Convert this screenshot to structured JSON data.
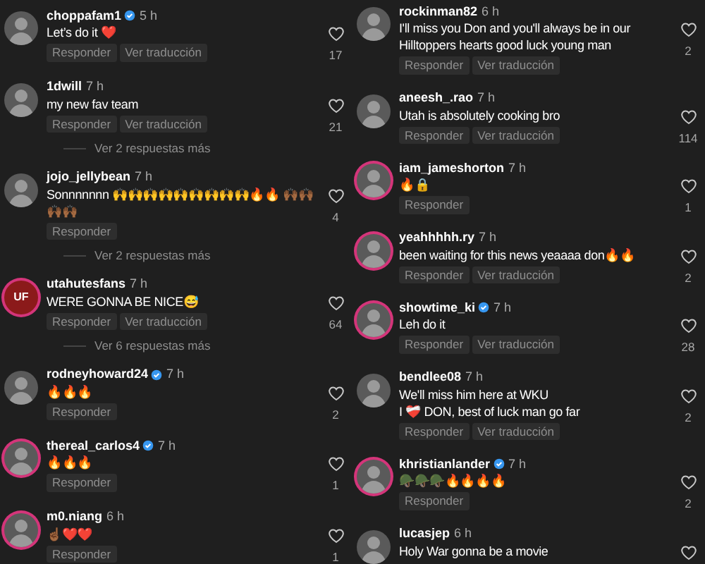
{
  "columns": [
    {
      "comments": [
        {
          "username": "choppafam1",
          "verified": true,
          "time": "5 h",
          "story_ring": false,
          "lines": [
            "Let’s do it ❤️"
          ],
          "actions": [
            "Responder",
            "Ver traducción"
          ],
          "likes": "17"
        },
        {
          "username": "1dwill",
          "verified": false,
          "time": "7 h",
          "story_ring": false,
          "lines": [
            "my new fav team"
          ],
          "actions": [
            "Responder",
            "Ver traducción"
          ],
          "likes": "21",
          "replies": "Ver 2 respuestas más"
        },
        {
          "username": "jojo_jellybean",
          "verified": false,
          "time": "7 h",
          "story_ring": false,
          "lines": [
            "Sonnnnnnn 🙌🙌🙌🙌🙌🙌🙌🙌🙌🔥🔥 🙌🏾🙌🏾🙌🏾🙌🏾"
          ],
          "actions": [
            "Responder"
          ],
          "likes": "4",
          "replies": "Ver 2 respuestas más"
        },
        {
          "username": "utahutesfans",
          "verified": false,
          "time": "7 h",
          "story_ring": true,
          "avatar_text": "UF",
          "lines": [
            "WERE GONNA BE NICE😅"
          ],
          "actions": [
            "Responder",
            "Ver traducción"
          ],
          "likes": "64",
          "replies": "Ver 6 respuestas más"
        },
        {
          "username": "rodneyhoward24",
          "verified": true,
          "time": "7 h",
          "story_ring": false,
          "lines": [
            "🔥🔥🔥"
          ],
          "actions": [
            "Responder"
          ],
          "likes": "2"
        },
        {
          "username": "thereal_carlos4",
          "verified": true,
          "time": "7 h",
          "story_ring": true,
          "lines": [
            "🔥🔥🔥"
          ],
          "actions": [
            "Responder"
          ],
          "likes": "1"
        },
        {
          "username": "m0.niang",
          "verified": false,
          "time": "6 h",
          "story_ring": true,
          "lines": [
            "☝🏾❤️❤️"
          ],
          "actions": [
            "Responder"
          ],
          "likes": "1"
        }
      ]
    },
    {
      "comments": [
        {
          "username": "rockinman82",
          "verified": false,
          "time": "6 h",
          "story_ring": false,
          "lines": [
            "I'll miss you Don and you'll always be in our",
            "Hilltoppers hearts good luck young man"
          ],
          "actions": [
            "Responder",
            "Ver traducción"
          ],
          "likes": "2"
        },
        {
          "username": "aneesh_.rao",
          "verified": false,
          "time": "7 h",
          "story_ring": false,
          "lines": [
            "Utah is absolutely cooking bro"
          ],
          "actions": [
            "Responder",
            "Ver traducción"
          ],
          "likes": "114"
        },
        {
          "username": "iam_jameshorton",
          "verified": false,
          "time": "7 h",
          "story_ring": true,
          "lines": [
            "🔥🔒"
          ],
          "actions": [
            "Responder"
          ],
          "likes": "1"
        },
        {
          "username": "yeahhhhh.ry",
          "verified": false,
          "time": "7 h",
          "story_ring": true,
          "lines": [
            "been waiting for this news yeaaaa don🔥🔥"
          ],
          "actions": [
            "Responder",
            "Ver traducción"
          ],
          "likes": "2"
        },
        {
          "username": "showtime_ki",
          "verified": true,
          "time": "7 h",
          "story_ring": true,
          "lines": [
            "Leh do it"
          ],
          "actions": [
            "Responder",
            "Ver traducción"
          ],
          "likes": "28"
        },
        {
          "username": "bendlee08",
          "verified": false,
          "time": "7 h",
          "story_ring": false,
          "lines": [
            "We'll miss him here at WKU",
            "I ❤️‍🩹 DON, best of luck man go far"
          ],
          "actions": [
            "Responder",
            "Ver traducción"
          ],
          "likes": "2"
        },
        {
          "username": "khristianlander",
          "verified": true,
          "time": "7 h",
          "story_ring": true,
          "lines": [
            "🪖🪖🪖🔥🔥🔥🔥"
          ],
          "actions": [
            "Responder"
          ],
          "likes": "2"
        },
        {
          "username": "lucasjep",
          "verified": false,
          "time": "6 h",
          "story_ring": false,
          "lines": [
            "Holy War gonna be a movie"
          ]
        }
      ]
    }
  ]
}
